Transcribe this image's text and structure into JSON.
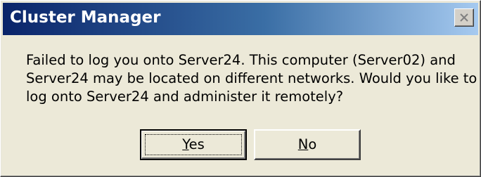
{
  "window": {
    "title": "Cluster Manager"
  },
  "message": {
    "lines": [
      "Failed to log you onto Server24. This computer (Server02) and",
      "Server24 may be located on different networks. Would you like to",
      "log onto Server24 and administer it remotely?"
    ]
  },
  "buttons": {
    "yes": {
      "accel": "Y",
      "rest": "es"
    },
    "no": {
      "accel": "N",
      "rest": "o"
    }
  },
  "icons": {
    "close": "close-icon"
  }
}
